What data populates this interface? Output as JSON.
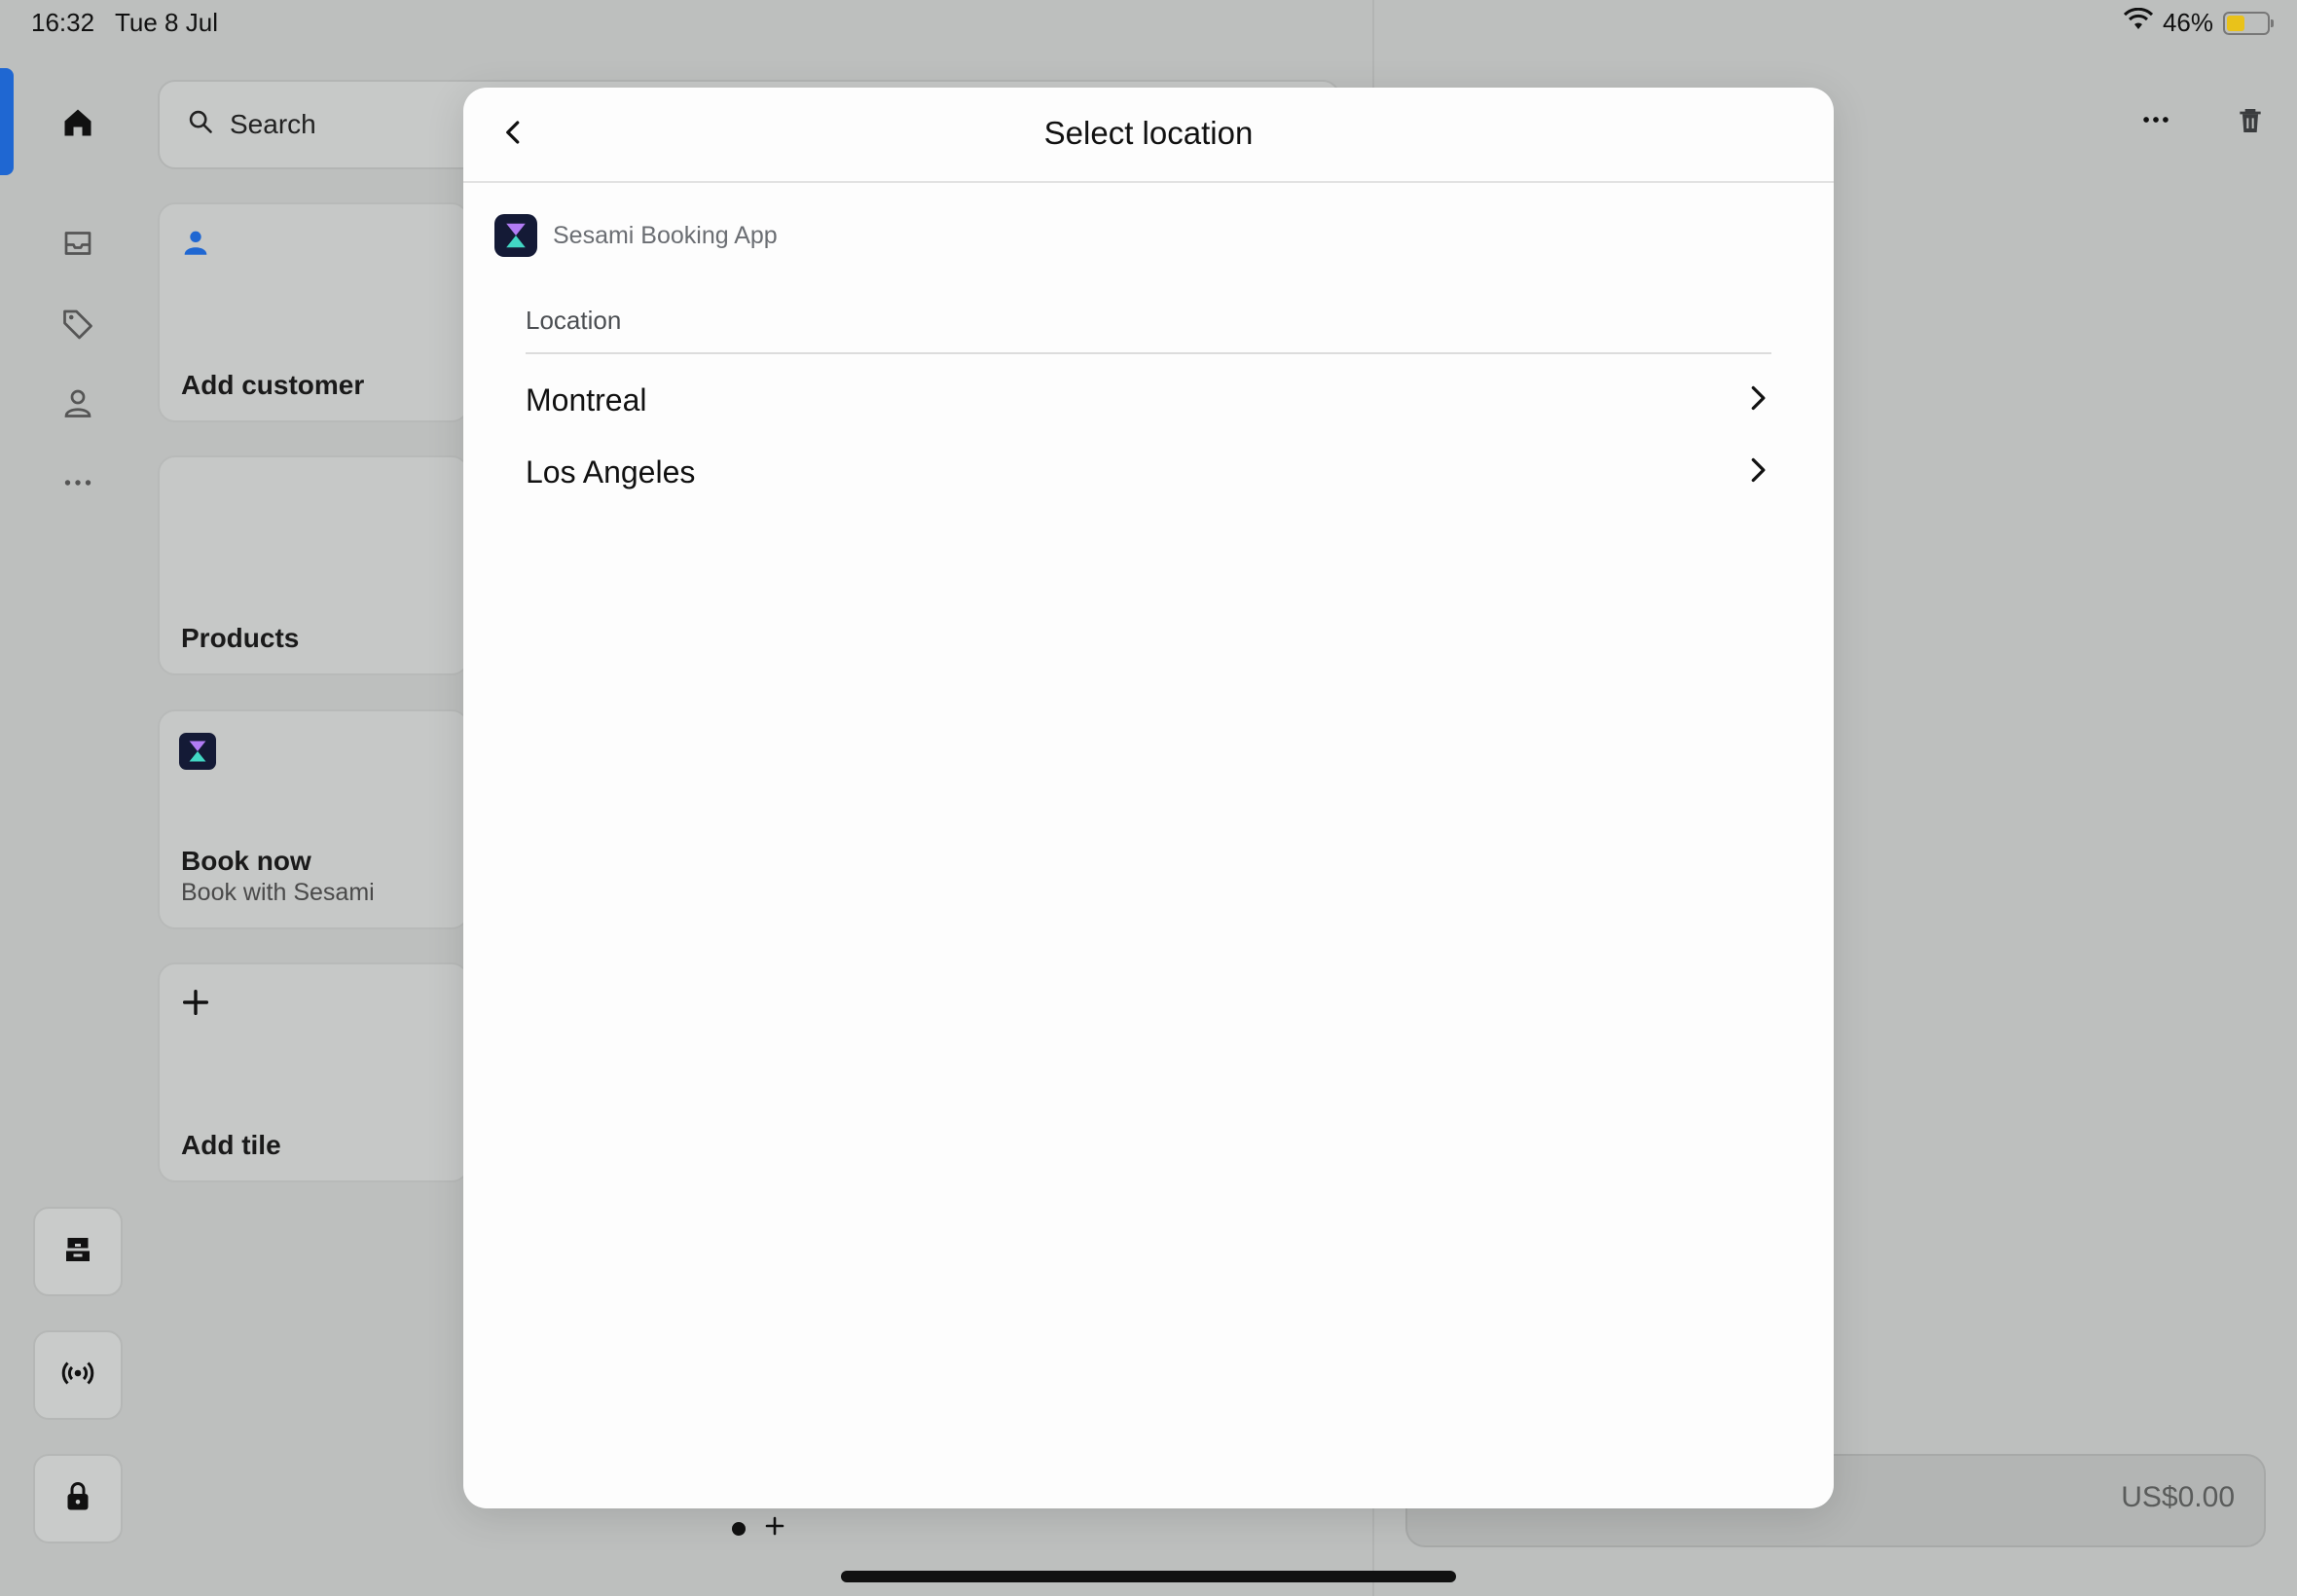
{
  "status_bar": {
    "time": "16:32",
    "date": "Tue 8 Jul",
    "battery": "46%",
    "battery_level": 0.46,
    "battery_color": "#e9c21a"
  },
  "nav_rail": {
    "items": [
      "home-icon",
      "inbox-icon",
      "tag-icon",
      "person-icon",
      "more-icon"
    ],
    "bottom_buttons": [
      "register-icon",
      "broadcast-icon",
      "lock-icon"
    ],
    "accent": "#1f67d2"
  },
  "search": {
    "label": "Search"
  },
  "tiles": [
    {
      "title": "Add customer",
      "icon": "person-icon"
    },
    {
      "title": "Products"
    },
    {
      "title": "Book now",
      "subtitle": "Book with Sesami",
      "icon": "sesami-logo-icon"
    },
    {
      "title": "Add tile",
      "icon": "plus-icon"
    }
  ],
  "cart": {
    "total": "US$0.00"
  },
  "modal": {
    "title": "Select location",
    "app_name": "Sesami Booking App",
    "section_label": "Location",
    "locations": [
      {
        "label": "Montreal"
      },
      {
        "label": "Los Angeles"
      }
    ]
  }
}
